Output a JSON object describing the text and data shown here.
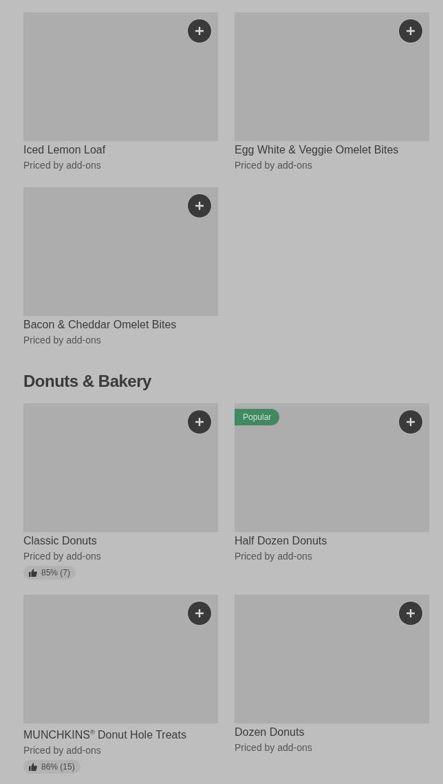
{
  "sections": [
    {
      "items": [
        {
          "image": {
            "kind": "placeholder"
          },
          "name": "Iced Lemon Loaf",
          "price_note": "Priced by add-ons"
        },
        {
          "image": {
            "kind": "placeholder"
          },
          "name": "Bacon & Cheddar Omelet Bites",
          "price_note": "Priced by add-ons"
        },
        {
          "image": {
            "kind": "placeholder"
          },
          "name": "Egg White & Veggie Omelet Bites",
          "price_note": "Priced by add-ons"
        }
      ]
    },
    {
      "heading": "Donuts & Bakery",
      "items": [
        {
          "image": {
            "kind": "placeholder"
          },
          "name": "Classic Donuts",
          "price_note": "Priced by add-ons",
          "rating": "85% (7)"
        },
        {
          "image": {
            "kind": "placeholder"
          },
          "name": "MUNCHKINS$^{®}$ Donut Hole Treats",
          "price_note": "Priced by add-ons",
          "rating": "86% (15)"
        },
        {
          "image": {
            "kind": "placeholder"
          },
          "name": "Half Dozen Donuts",
          "price_note": "Priced by add-ons",
          "badge": "Popular"
        },
        {
          "image": {
            "kind": "placeholder"
          },
          "name": "Dozen Donuts",
          "price_note": "Priced by add-ons"
        }
      ]
    }
  ]
}
